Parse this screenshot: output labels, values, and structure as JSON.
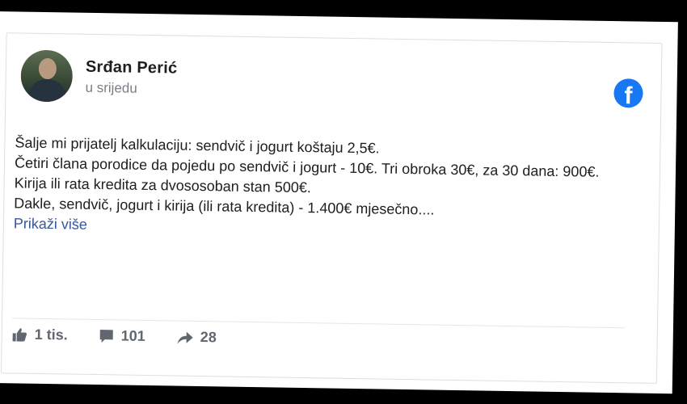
{
  "post": {
    "author": "Srđan Perić",
    "time": "u srijedu",
    "lines": [
      "Šalje mi prijatelj kalkulaciju: sendvič i jogurt koštaju 2,5€.",
      "Četiri člana porodice da pojedu po sendvič i jogurt - 10€. Tri obroka 30€, za 30 dana: 900€.",
      "Kirija ili rata kredita za dvososoban stan 500€.",
      "Dakle, sendvič, jogurt i kirija (ili rata kredita) - 1.400€ mjesečno...."
    ],
    "see_more": "Prikaži više",
    "platform_icon": "f"
  },
  "actions": {
    "likes": "1 tis.",
    "comments": "101",
    "shares": "28"
  },
  "colors": {
    "facebook_blue": "#1877f2",
    "link": "#385898",
    "meta_text": "#606770"
  }
}
